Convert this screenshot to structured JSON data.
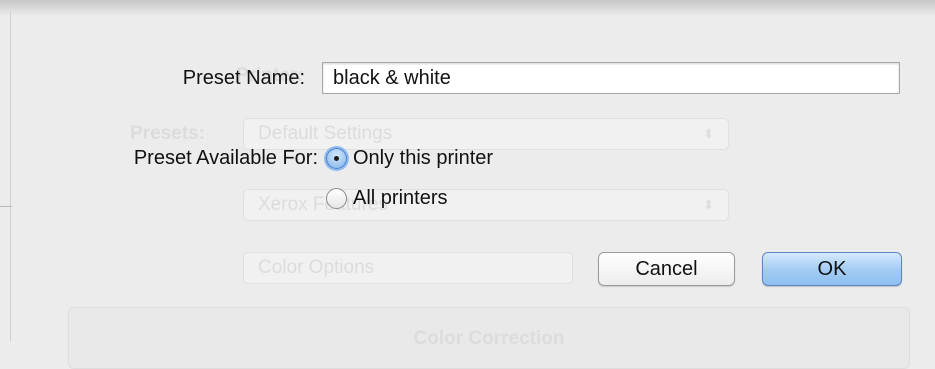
{
  "dialog": {
    "preset_name_label": "Preset Name:",
    "preset_name_value": "black & white",
    "available_label": "Preset Available For:",
    "options": [
      {
        "label": "Only this printer",
        "selected": true
      },
      {
        "label": "All printers",
        "selected": false
      }
    ],
    "cancel_label": "Cancel",
    "ok_label": "OK"
  },
  "background": {
    "printer_label": "Printer:",
    "printer_value": "Xerox",
    "presets_label": "Presets:",
    "presets_value": "Default Settings",
    "third_value": "Xerox Features",
    "fourth_value": "Color Options",
    "group_title": "Color Correction"
  },
  "colors": {
    "accent": "#7fb3ea",
    "ok_button": "#a5cdf4"
  }
}
